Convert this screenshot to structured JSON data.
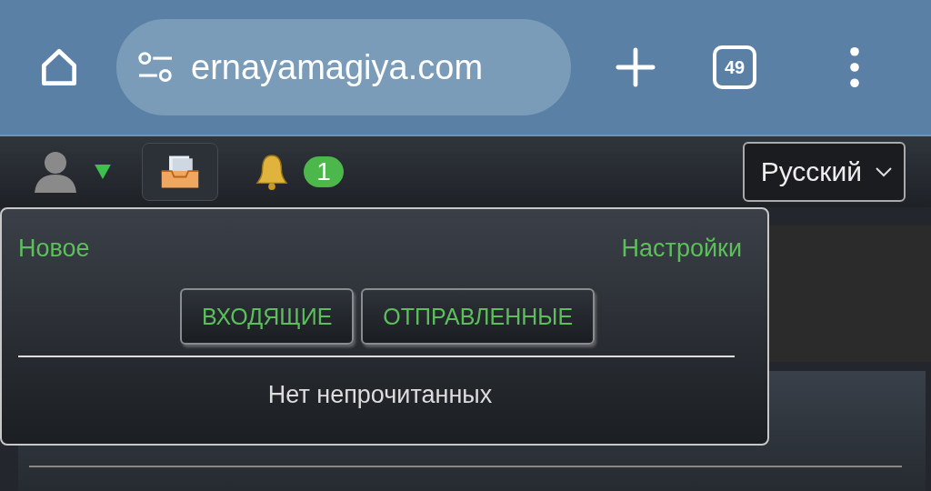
{
  "browser": {
    "url": "ernayamagiya.com",
    "tab_count": "49"
  },
  "nav": {
    "inbox_active": true,
    "notification_count": "1",
    "language": "Русский"
  },
  "popup": {
    "new_link": "Новое",
    "settings_link": "Настройки",
    "tabs": [
      {
        "label": "ВХОДЯЩИЕ"
      },
      {
        "label": "ОТПРАВЛЕННЫЕ"
      }
    ],
    "empty_text": "Нет непрочитанных"
  }
}
